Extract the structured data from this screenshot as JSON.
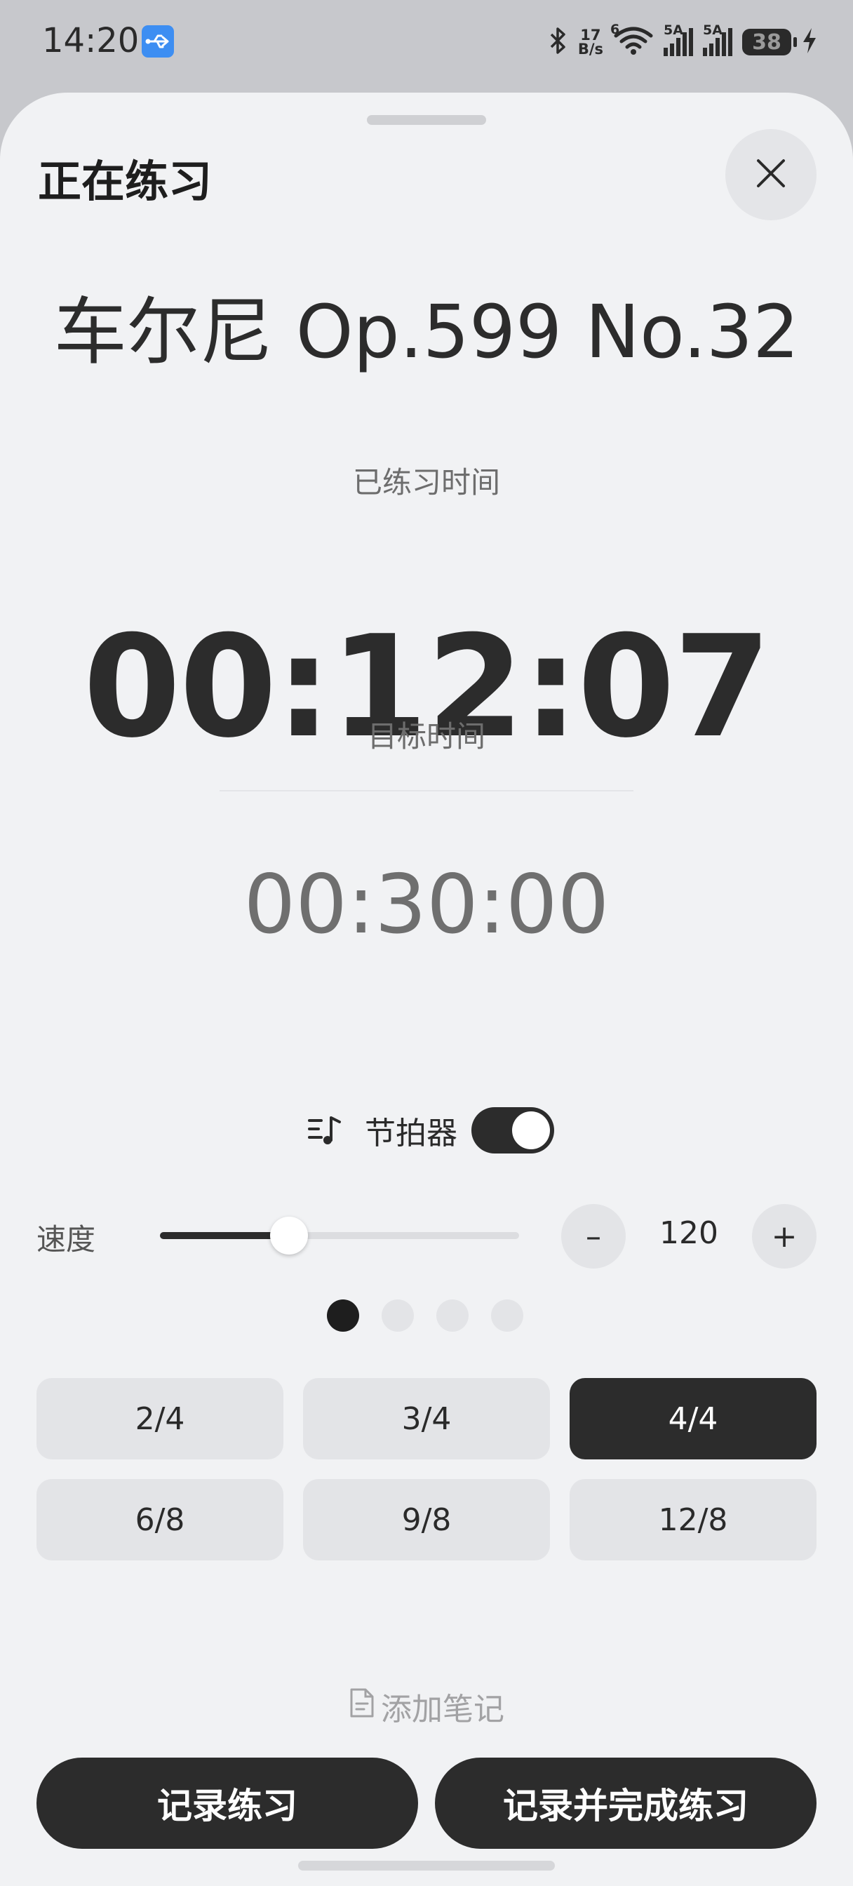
{
  "status_bar": {
    "time": "14:20",
    "net_speed_top": "17",
    "net_speed_bottom": "B/s",
    "signal1_label": "5A",
    "signal2_label": "5A",
    "wifi_badge": "6",
    "battery": "38"
  },
  "sheet": {
    "title": "正在练习",
    "piece_title": "车尔尼 Op.599 No.32",
    "elapsed_label": "已练习时间",
    "elapsed_time": "00:12:07",
    "target_label": "目标时间",
    "target_time": "00:30:00"
  },
  "metronome": {
    "label": "节拍器",
    "enabled": true,
    "speed_label": "速度",
    "bpm": "120",
    "slider_fraction": 0.36,
    "minus_label": "–",
    "plus_label": "+",
    "beat_dots": 4,
    "active_beat": 1,
    "time_signatures": [
      "2/4",
      "3/4",
      "4/4",
      "6/8",
      "9/8",
      "12/8"
    ],
    "selected_time_signature": "4/4"
  },
  "note": {
    "label": "添加笔记"
  },
  "actions": {
    "record": "记录练习",
    "record_finish": "记录并完成练习"
  },
  "colors": {
    "primary_dark": "#2c2c2c",
    "sheet_bg": "#f1f2f4",
    "chip_bg": "#e3e4e7",
    "usb_badge": "#3d8ef2"
  }
}
